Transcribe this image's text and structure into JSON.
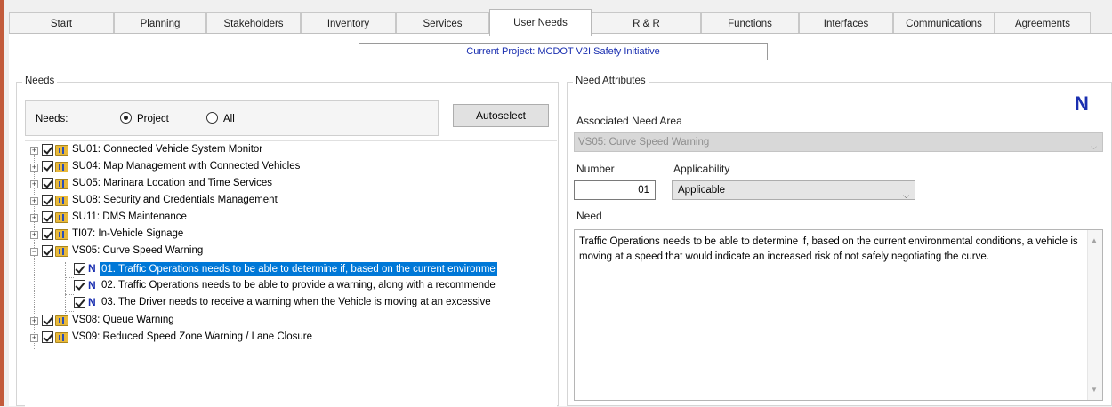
{
  "tabs": [
    {
      "label": "Start",
      "active": false
    },
    {
      "label": "Planning",
      "active": false
    },
    {
      "label": "Stakeholders",
      "active": false
    },
    {
      "label": "Inventory",
      "active": false
    },
    {
      "label": "Services",
      "active": false
    },
    {
      "label": "User Needs",
      "active": true
    },
    {
      "label": "R & R",
      "active": false
    },
    {
      "label": "Functions",
      "active": false
    },
    {
      "label": "Interfaces",
      "active": false
    },
    {
      "label": "Communications",
      "active": false
    },
    {
      "label": "Agreements",
      "active": false
    }
  ],
  "current_project": "Current Project: MCDOT V2I Safety Initiative",
  "needs_panel": {
    "title": "Needs",
    "filter_label": "Needs:",
    "radio_options": [
      {
        "label": "Project",
        "selected": true
      },
      {
        "label": "All",
        "selected": false
      }
    ],
    "autoselect_label": "Autoselect",
    "tree": [
      {
        "label": "SU01: Connected Vehicle System Monitor",
        "level": 0,
        "expanded": false,
        "checked": true
      },
      {
        "label": "SU04: Map Management with Connected Vehicles",
        "level": 0,
        "expanded": false,
        "checked": true
      },
      {
        "label": "SU05: Marinara Location and Time Services",
        "level": 0,
        "expanded": false,
        "checked": true
      },
      {
        "label": "SU08: Security and Credentials Management",
        "level": 0,
        "expanded": false,
        "checked": true
      },
      {
        "label": "SU11: DMS Maintenance",
        "level": 0,
        "expanded": false,
        "checked": true
      },
      {
        "label": "TI07: In-Vehicle Signage",
        "level": 0,
        "expanded": false,
        "checked": true
      },
      {
        "label": "VS05: Curve Speed Warning",
        "level": 0,
        "expanded": true,
        "checked": true
      },
      {
        "label": "01. Traffic Operations needs to be able to determine if, based on the current environme",
        "level": 1,
        "checked": true,
        "selected": true
      },
      {
        "label": "02. Traffic Operations needs to be able to provide a warning, along with a recommende",
        "level": 1,
        "checked": true,
        "selected": false
      },
      {
        "label": "03. The Driver needs to receive a warning when the Vehicle is moving at an excessive",
        "level": 1,
        "checked": true,
        "selected": false
      },
      {
        "label": "VS08: Queue Warning",
        "level": 0,
        "expanded": false,
        "checked": true
      },
      {
        "label": "VS09: Reduced Speed Zone Warning / Lane Closure",
        "level": 0,
        "expanded": false,
        "checked": true
      }
    ]
  },
  "attributes_panel": {
    "title": "Need Attributes",
    "badge": "N",
    "associated_need_area_label": "Associated Need Area",
    "associated_need_area_value": "VS05: Curve Speed Warning",
    "number_label": "Number",
    "number_value": "01",
    "applicability_label": "Applicability",
    "applicability_value": "Applicable",
    "need_label": "Need",
    "need_text": "Traffic Operations needs to be able to determine if, based on the current environmental conditions, a vehicle is moving at a speed that would indicate an increased risk of not safely negotiating the curve."
  },
  "icons": {
    "expander_plus": "+",
    "expander_minus": "−",
    "chevron_down": "⌵",
    "scroll_up": "▲",
    "scroll_down": "▼",
    "need_item_icon": "N"
  }
}
